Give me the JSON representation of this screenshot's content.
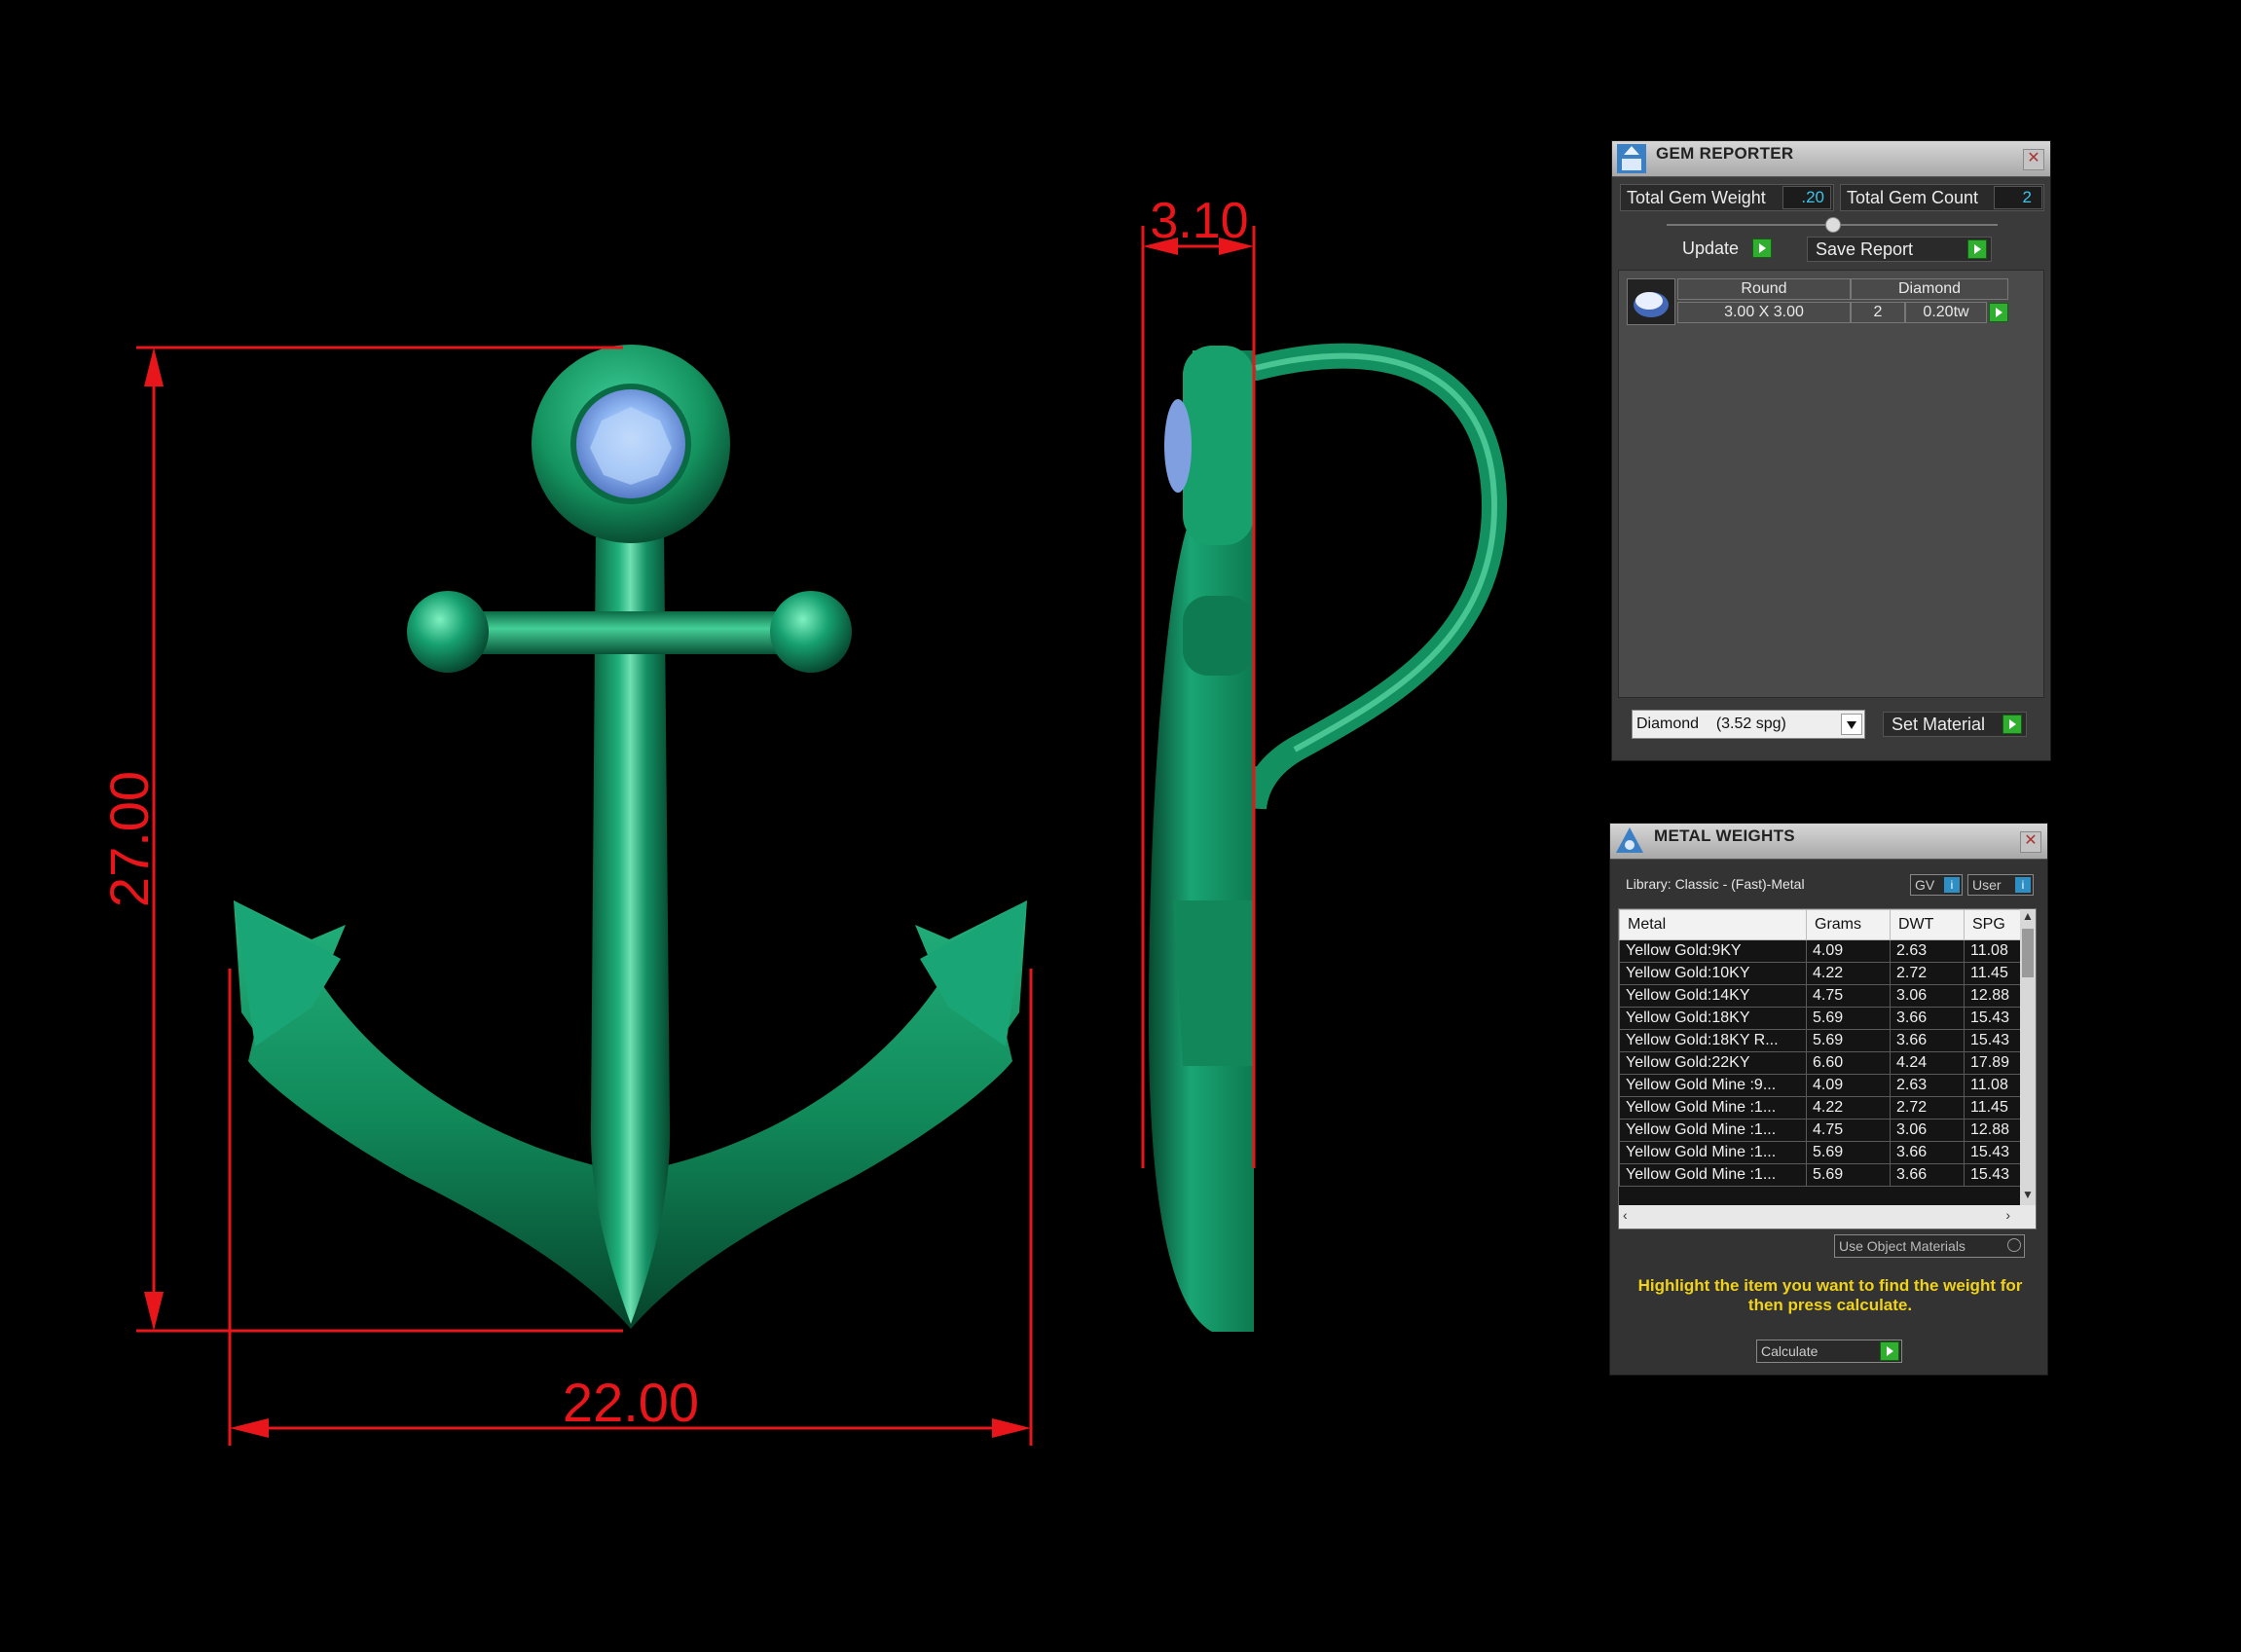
{
  "dimensions": {
    "height_front": "27.00",
    "width_front": "22.00",
    "thickness_side": "3.10"
  },
  "gem_reporter": {
    "title": "GEM REPORTER",
    "total_gem_weight_label": "Total Gem Weight",
    "total_gem_weight_value": ".20",
    "total_gem_count_label": "Total Gem Count",
    "total_gem_count_value": "2",
    "update_label": "Update",
    "save_report_label": "Save Report",
    "gem_row": {
      "shape": "Round",
      "material": "Diamond",
      "size": "3.00 X 3.00",
      "count": "2",
      "weight": "0.20tw"
    },
    "material_select": "Diamond    (3.52 spg)",
    "set_material_label": "Set Material"
  },
  "metal_weights": {
    "title": "METAL WEIGHTS",
    "library_label": "Library: Classic - (Fast)-Metal",
    "gv_label": "GV",
    "user_label": "User",
    "columns": [
      "Metal",
      "Grams",
      "DWT",
      "SPG"
    ],
    "rows": [
      {
        "metal": "Yellow Gold:9KY",
        "grams": "4.09",
        "dwt": "2.63",
        "spg": "11.08"
      },
      {
        "metal": "Yellow Gold:10KY",
        "grams": "4.22",
        "dwt": "2.72",
        "spg": "11.45"
      },
      {
        "metal": "Yellow Gold:14KY",
        "grams": "4.75",
        "dwt": "3.06",
        "spg": "12.88"
      },
      {
        "metal": "Yellow Gold:18KY",
        "grams": "5.69",
        "dwt": "3.66",
        "spg": "15.43"
      },
      {
        "metal": "Yellow Gold:18KY R...",
        "grams": "5.69",
        "dwt": "3.66",
        "spg": "15.43"
      },
      {
        "metal": "Yellow Gold:22KY",
        "grams": "6.60",
        "dwt": "4.24",
        "spg": "17.89"
      },
      {
        "metal": "Yellow Gold Mine :9...",
        "grams": "4.09",
        "dwt": "2.63",
        "spg": "11.08"
      },
      {
        "metal": "Yellow Gold Mine :1...",
        "grams": "4.22",
        "dwt": "2.72",
        "spg": "11.45"
      },
      {
        "metal": "Yellow Gold Mine :1...",
        "grams": "4.75",
        "dwt": "3.06",
        "spg": "12.88"
      },
      {
        "metal": "Yellow Gold Mine :1...",
        "grams": "5.69",
        "dwt": "3.66",
        "spg": "15.43"
      },
      {
        "metal": "Yellow Gold Mine :1...",
        "grams": "5.69",
        "dwt": "3.66",
        "spg": "15.43"
      }
    ],
    "use_object_materials_label": "Use Object Materials",
    "hint": "Highlight the item you want to find the weight for then press calculate.",
    "calculate_label": "Calculate"
  },
  "colors": {
    "background": "#000000",
    "dimension_red": "#e8161b",
    "metal_green": "#17a06b",
    "gem_blue": "#8ab4f0",
    "hint_yellow": "#f0d21a"
  }
}
